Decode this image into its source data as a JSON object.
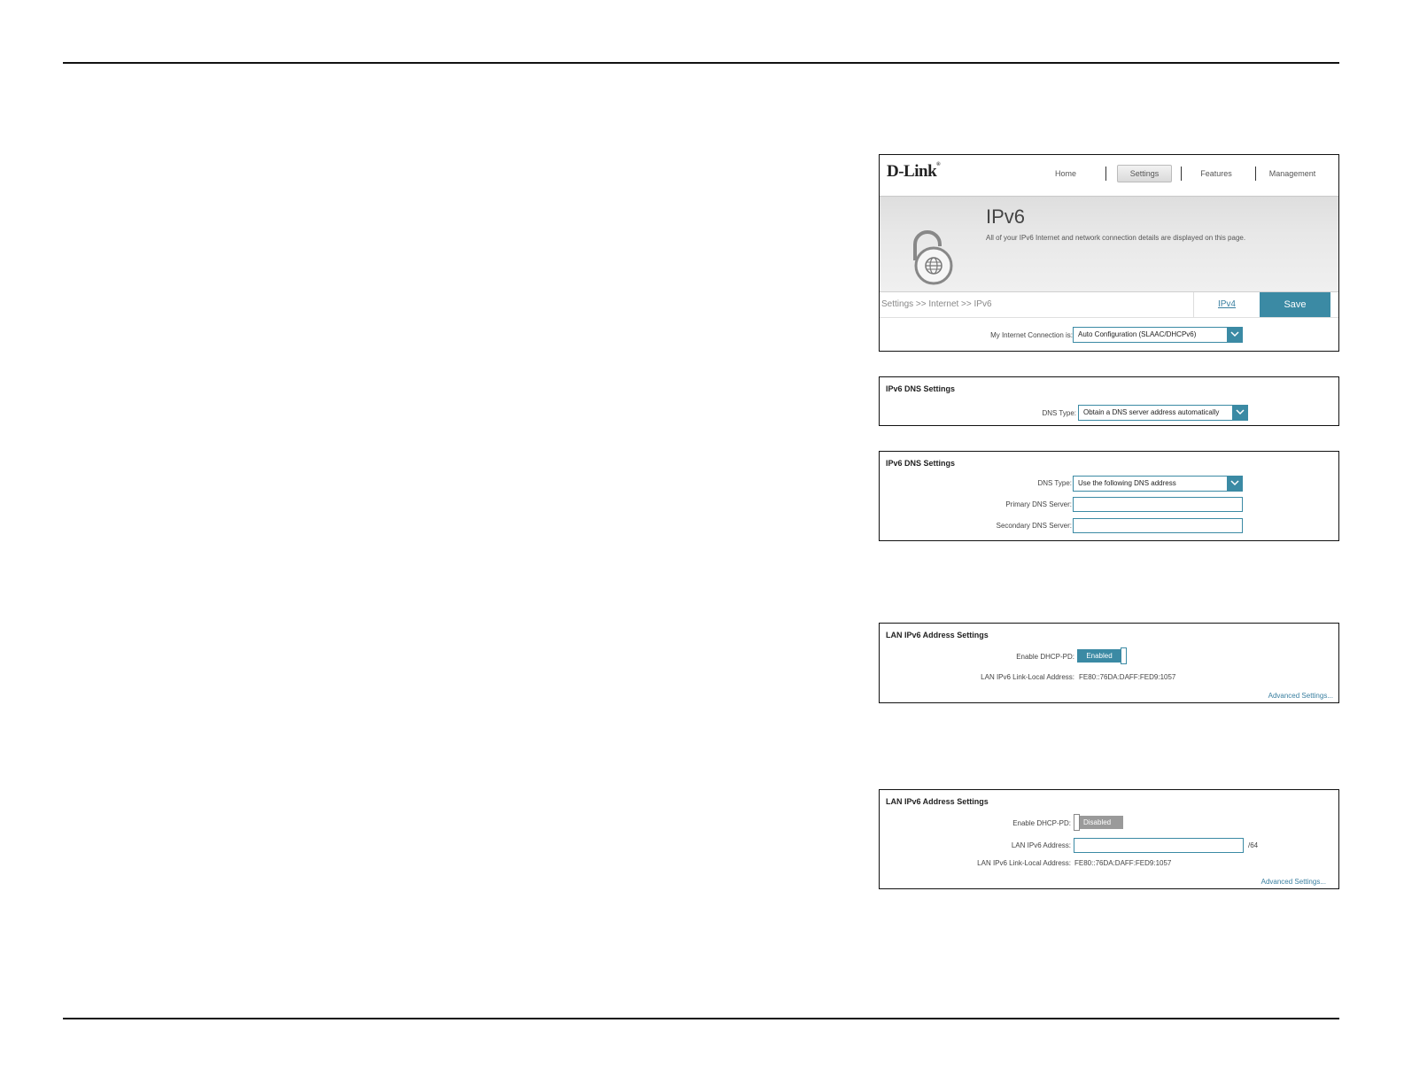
{
  "header": {
    "logo": "D-Link",
    "nav": [
      "Home",
      "Settings",
      "Features",
      "Management"
    ],
    "active_nav": "Settings",
    "title": "IPv6",
    "description": "All of your IPv6 Internet and network connection details are displayed on this page.",
    "breadcrumb": "Settings >> Internet >> IPv6",
    "ipv4_link": "IPv4",
    "save_label": "Save",
    "connection_label": "My Internet Connection is:",
    "connection_value": "Auto Configuration (SLAAC/DHCPv6)"
  },
  "dns_auto": {
    "title": "IPv6 DNS Settings",
    "dns_type_label": "DNS Type:",
    "dns_type_value": "Obtain a DNS server address automatically"
  },
  "dns_manual": {
    "title": "IPv6 DNS Settings",
    "dns_type_label": "DNS Type:",
    "dns_type_value": "Use the following DNS address",
    "primary_label": "Primary DNS Server:",
    "primary_value": "",
    "secondary_label": "Secondary DNS Server:",
    "secondary_value": ""
  },
  "lan_enabled": {
    "title": "LAN IPv6 Address Settings",
    "dhcp_pd_label": "Enable DHCP-PD:",
    "dhcp_pd_state": "Enabled",
    "link_local_label": "LAN IPv6 Link-Local Address:",
    "link_local_value": "FE80::76DA:DAFF:FED9:1057",
    "advanced_link": "Advanced Settings..."
  },
  "lan_disabled": {
    "title": "LAN IPv6 Address Settings",
    "dhcp_pd_label": "Enable DHCP-PD:",
    "dhcp_pd_state": "Disabled",
    "address_label": "LAN IPv6 Address:",
    "address_value": "",
    "prefix_suffix": "/64",
    "link_local_label": "LAN IPv6 Link-Local Address:",
    "link_local_value": "FE80::76DA:DAFF:FED9:1057",
    "advanced_link": "Advanced Settings..."
  },
  "colors": {
    "accent": "#3b8aa4",
    "disabled": "#9a9a9a"
  }
}
